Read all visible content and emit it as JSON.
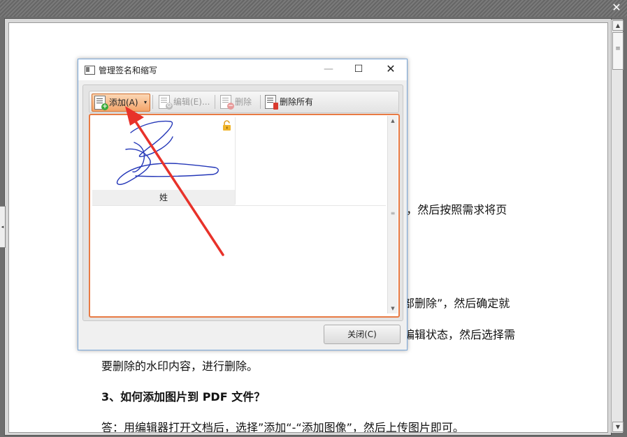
{
  "viewer": {
    "close_glyph": "✕",
    "scroll_up": "▲",
    "scroll_down": "▼",
    "scroll_grip": "≡",
    "side_handle": "◂"
  },
  "document": {
    "fragment_1": "”，然后按照需求将页",
    "fragment_2": "部删除”，然后确定就",
    "fragment_3": "编辑状态，然后选择需",
    "line_watermark": "要删除的水印内容，进行删除。",
    "heading_3": "3、如何添加图片到 PDF 文件？",
    "answer_3": "答：用编辑器打开文档后，选择”添加“-“添加图像”，然后上传图片即可。"
  },
  "dialog": {
    "title": "管理签名和缩写",
    "minimize": "—",
    "maximize": "☐",
    "close": "✕",
    "toolbar": {
      "add_label": "添加(A)",
      "add_dropdown": "▾",
      "edit_label": "编辑(E)...",
      "delete_label": "删除",
      "delete_all_label": "删除所有"
    },
    "signatures": [
      {
        "label": "姓",
        "locked": true
      }
    ],
    "close_button": "关闭(C)"
  },
  "colors": {
    "accent_orange": "#e87a43",
    "arrow_red": "#e8322a",
    "signature_ink": "#2437b8"
  }
}
